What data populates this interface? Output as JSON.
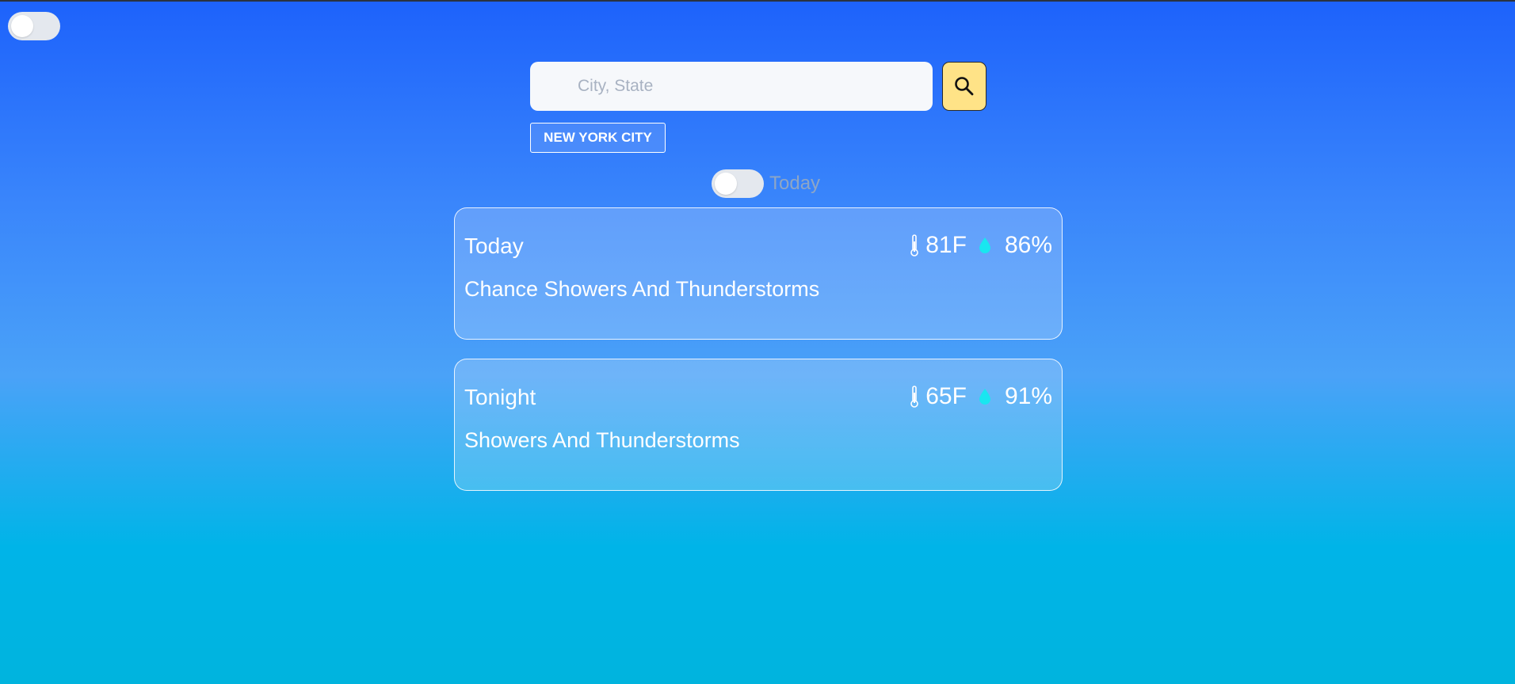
{
  "search": {
    "placeholder": "City, State",
    "button_icon": "search-icon"
  },
  "recent_city": "NEW YORK CITY",
  "period_toggle": {
    "label": "Today",
    "on": false
  },
  "dark_mode_toggle": {
    "on": false
  },
  "forecast": [
    {
      "title": "Today",
      "temperature": "81F",
      "humidity": "86%",
      "description": "Chance Showers And Thunderstorms"
    },
    {
      "title": "Tonight",
      "temperature": "65F",
      "humidity": "91%",
      "description": "Showers And Thunderstorms"
    }
  ],
  "colors": {
    "background_top": "#1d62fb",
    "background_bottom": "#00b4de",
    "search_button": "#ffe387",
    "humidity_icon": "#19e6f0"
  }
}
